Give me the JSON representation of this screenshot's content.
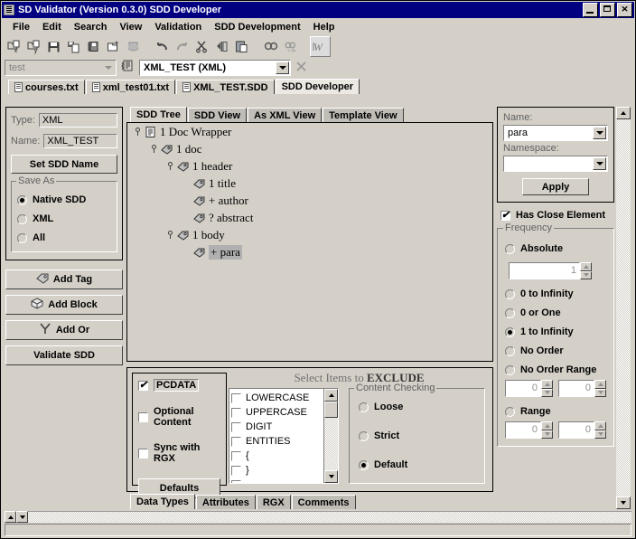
{
  "window": {
    "title": "SD Validator (Version 0.3.0) SDD Developer",
    "app_icon": "document-icon",
    "minimize": "_",
    "maximize": "□",
    "close": "✕"
  },
  "menubar": {
    "items": [
      {
        "label": "File"
      },
      {
        "label": "Edit"
      },
      {
        "label": "Search"
      },
      {
        "label": "View"
      },
      {
        "label": "Validation"
      },
      {
        "label": "SDD Development"
      },
      {
        "label": "Help"
      }
    ]
  },
  "toolbar": {
    "items": [
      {
        "name": "open-xml-icon"
      },
      {
        "name": "open-sdd-icon"
      },
      {
        "name": "save-icon"
      },
      {
        "name": "save-as-icon"
      },
      {
        "name": "save-all-icon"
      },
      {
        "name": "new-file-icon"
      },
      {
        "name": "print-icon"
      },
      {
        "name": "undo-icon"
      },
      {
        "name": "redo-icon"
      },
      {
        "name": "cut-icon"
      },
      {
        "name": "copy-icon"
      },
      {
        "name": "paste-icon"
      },
      {
        "name": "find-icon"
      },
      {
        "name": "find-next-icon"
      },
      {
        "name": "word-wrap-icon"
      }
    ]
  },
  "selector_bar": {
    "left_combo": {
      "value": "test",
      "enabled": false
    },
    "sdd_icon": "sdd-doc-icon",
    "right_combo": {
      "value": "XML_TEST (XML)",
      "enabled": true
    },
    "close_icon": "close-x-icon"
  },
  "file_tabs": {
    "items": [
      {
        "label": "courses.txt",
        "active": false,
        "icon": "file-icon"
      },
      {
        "label": "xml_test01.txt",
        "active": false,
        "icon": "file-icon"
      },
      {
        "label": "XML_TEST.SDD",
        "active": false,
        "icon": "file-icon"
      },
      {
        "label": "SDD Developer",
        "active": true,
        "icon": ""
      }
    ]
  },
  "left_panel": {
    "type_label": "Type:",
    "type_value": "XML",
    "name_label": "Name:",
    "name_value": "XML_TEST",
    "set_name_button": "Set SDD Name",
    "save_as": {
      "legend": "Save As",
      "options": [
        {
          "label": "Native SDD",
          "selected": true
        },
        {
          "label": "XML",
          "selected": false
        },
        {
          "label": "All",
          "selected": false
        }
      ]
    },
    "buttons": [
      {
        "label": "Add Tag",
        "icon": "tag-icon"
      },
      {
        "label": "Add Block",
        "icon": "cube-icon"
      },
      {
        "label": "Add Or",
        "icon": "branch-icon"
      },
      {
        "label": "Validate SDD",
        "icon": ""
      }
    ]
  },
  "view_tabs": {
    "items": [
      {
        "label": "SDD Tree",
        "active": true
      },
      {
        "label": "SDD View",
        "active": false
      },
      {
        "label": "As XML View",
        "active": false
      },
      {
        "label": "Template View",
        "active": false
      }
    ]
  },
  "tree": {
    "nodes": [
      {
        "label": "1 Doc Wrapper",
        "depth": 0,
        "handle": true,
        "icon": "document-node-icon",
        "selected": false
      },
      {
        "label": "1 doc",
        "depth": 1,
        "handle": true,
        "icon": "tag-node-icon",
        "selected": false
      },
      {
        "label": "1 header",
        "depth": 2,
        "handle": true,
        "icon": "tag-node-icon",
        "selected": false
      },
      {
        "label": "1 title",
        "depth": 3,
        "handle": false,
        "icon": "tag-node-icon",
        "selected": false
      },
      {
        "label": "+ author",
        "depth": 3,
        "handle": false,
        "icon": "tag-node-icon",
        "selected": false
      },
      {
        "label": "? abstract",
        "depth": 3,
        "handle": false,
        "icon": "tag-node-icon",
        "selected": false
      },
      {
        "label": "1 body",
        "depth": 2,
        "handle": true,
        "icon": "tag-node-icon",
        "selected": false
      },
      {
        "label": "+ para",
        "depth": 3,
        "handle": false,
        "icon": "tag-node-icon",
        "selected": true
      }
    ]
  },
  "data_types_panel": {
    "checkboxes": [
      {
        "label": "PCDATA",
        "checked": true
      },
      {
        "label": "Optional Content",
        "checked": false
      },
      {
        "label": "Sync with RGX",
        "checked": false
      }
    ],
    "defaults_button": "Defaults",
    "exclude_header_prefix": "Select Items to ",
    "exclude_header_emphasis": "EXCLUDE",
    "exclude_items": [
      {
        "label": "LOWERCASE",
        "checked": false
      },
      {
        "label": "UPPERCASE",
        "checked": false
      },
      {
        "label": "DIGIT",
        "checked": false
      },
      {
        "label": "ENTITIES",
        "checked": false
      },
      {
        "label": "{",
        "checked": false
      },
      {
        "label": "}",
        "checked": false
      },
      {
        "label": ".",
        "checked": false
      }
    ],
    "content_checking": {
      "legend": "Content Checking",
      "options": [
        {
          "label": "Loose",
          "selected": false
        },
        {
          "label": "Strict",
          "selected": false
        },
        {
          "label": "Default",
          "selected": true
        }
      ]
    }
  },
  "bottom_tabs": {
    "items": [
      {
        "label": "Data Types",
        "active": true
      },
      {
        "label": "Attributes",
        "active": false
      },
      {
        "label": "RGX",
        "active": false
      },
      {
        "label": "Comments",
        "active": false
      }
    ]
  },
  "right_panel": {
    "name_label": "Name:",
    "name_value": "para",
    "namespace_label": "Namespace:",
    "namespace_value": "",
    "apply_button": "Apply",
    "has_close_element": {
      "label": "Has Close Element",
      "checked": true
    },
    "frequency": {
      "legend": "Frequency",
      "options": [
        {
          "label": "Absolute",
          "selected": false
        },
        {
          "label": "0 to Infinity",
          "selected": false
        },
        {
          "label": "0 or One",
          "selected": false
        },
        {
          "label": "1 to Infinity",
          "selected": true
        },
        {
          "label": "No Order",
          "selected": false
        },
        {
          "label": "No Order Range",
          "selected": false
        },
        {
          "label": "Range",
          "selected": false
        }
      ],
      "absolute_value": "1",
      "no_order_range_min": "0",
      "no_order_range_max": "0",
      "range_min": "0",
      "range_max": "0"
    }
  },
  "status_bar": {
    "text": ""
  },
  "colors": {
    "face": "#d4d0c8",
    "title_bar": "#000080",
    "selection": "#b0b0b0",
    "shadow": "#808080"
  }
}
